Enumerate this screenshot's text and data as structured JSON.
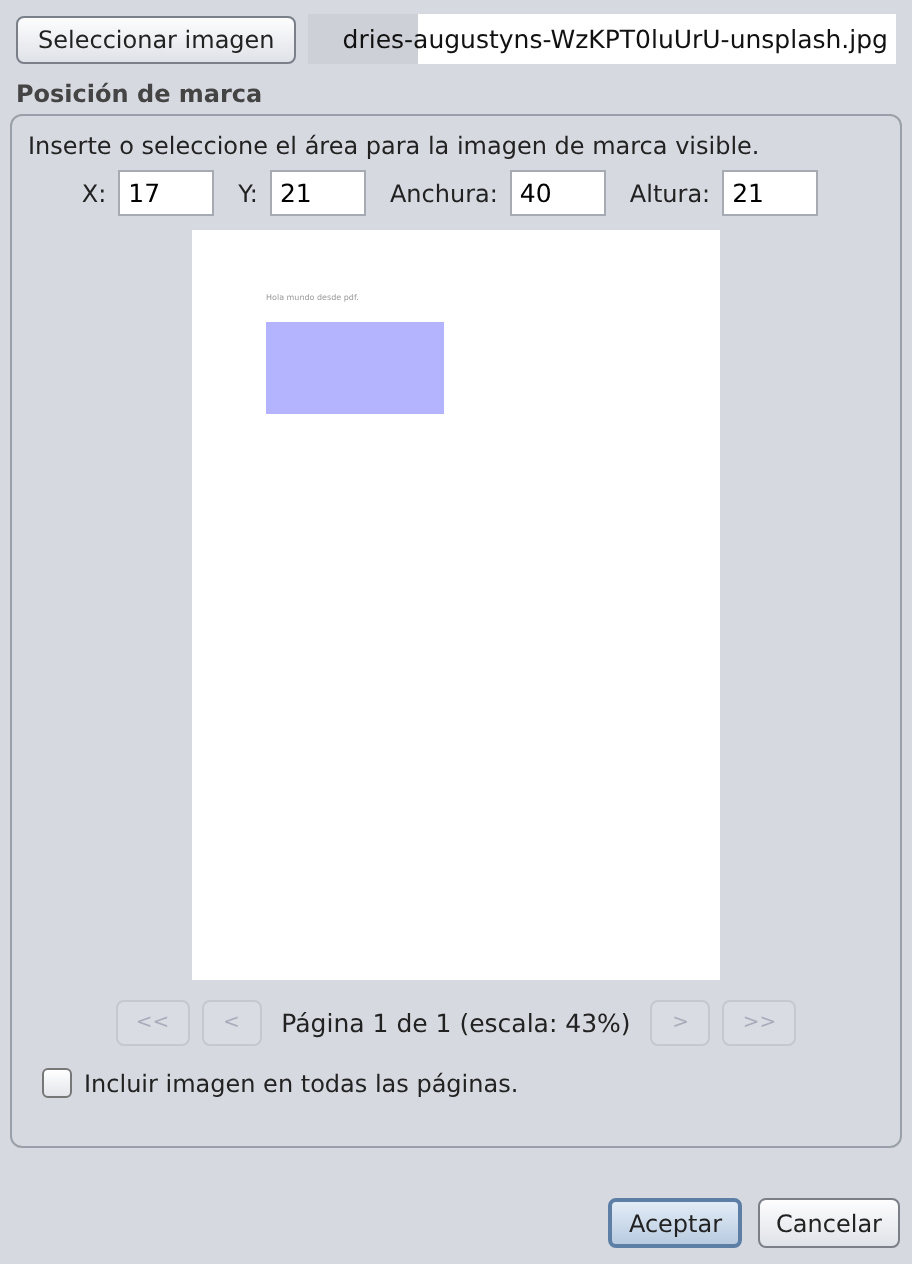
{
  "select_button": {
    "label": "Seleccionar imagen"
  },
  "file_field": {
    "value": "dries-augustyns-WzKPT0luUrU-unsplash.jpg"
  },
  "section": {
    "title": "Posición de marca",
    "instruction": "Inserte o seleccione el área para la imagen de marca visible.",
    "fields": [
      {
        "label": "X:",
        "value": "17"
      },
      {
        "label": "Y:",
        "value": "21"
      },
      {
        "label": "Anchura:",
        "value": "40"
      },
      {
        "label": "Altura:",
        "value": "21"
      }
    ],
    "preview": {
      "page_text": "Hola mundo desde pdf."
    },
    "nav_buttons": [
      {
        "label": "<<",
        "disabled": true
      },
      {
        "label": "<",
        "disabled": true
      },
      {
        "label": ">",
        "disabled": true
      },
      {
        "label": ">>",
        "disabled": true
      }
    ],
    "page_info": "Página 1 de 1 (escala: 43%)",
    "include_all": {
      "label": "Incluir imagen en todas las páginas.",
      "checked": false
    }
  },
  "buttons": [
    {
      "label": "Aceptar",
      "default": true
    },
    {
      "label": "Cancelar",
      "default": false
    }
  ]
}
